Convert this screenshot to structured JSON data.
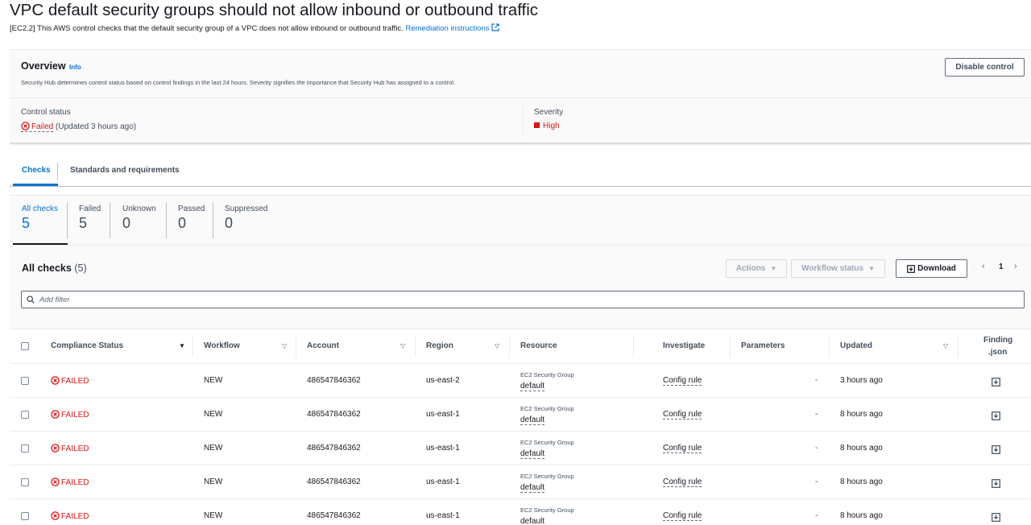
{
  "page": {
    "title": "VPC default security groups should not allow inbound or outbound traffic",
    "description": "[EC2.2] This AWS control checks that the default security group of a VPC does not allow inbound or outbound traffic.",
    "remediation_link": "Remediation instructions"
  },
  "overview": {
    "title": "Overview",
    "info": "Info",
    "description": "Security Hub determines control status based on control findings in the last 24 hours. Severity signifies the importance that Security Hub has assigned to a control.",
    "disable_button": "Disable control",
    "control_status_label": "Control status",
    "control_status_value": "Failed",
    "control_status_updated": "(Updated 3 hours ago)",
    "severity_label": "Severity",
    "severity_value": "High"
  },
  "tabs": [
    {
      "label": "Checks",
      "active": true
    },
    {
      "label": "Standards and requirements",
      "active": false
    }
  ],
  "stats": [
    {
      "label": "All checks",
      "value": "5"
    },
    {
      "label": "Failed",
      "value": "5"
    },
    {
      "label": "Unknown",
      "value": "0"
    },
    {
      "label": "Passed",
      "value": "0"
    },
    {
      "label": "Suppressed",
      "value": "0"
    }
  ],
  "table": {
    "title": "All checks",
    "count": "(5)",
    "actions_button": "Actions",
    "workflow_button": "Workflow status",
    "download_button": "Download",
    "page_number": "1",
    "filter_placeholder": "Add filter",
    "columns": {
      "compliance": "Compliance Status",
      "workflow": "Workflow",
      "account": "Account",
      "region": "Region",
      "resource": "Resource",
      "investigate": "Investigate",
      "parameters": "Parameters",
      "updated": "Updated",
      "finding_line1": "Finding",
      "finding_line2": ".json"
    },
    "rows": [
      {
        "status": "FAILED",
        "workflow": "NEW",
        "account": "486547846362",
        "region": "us-east-2",
        "resource_type": "EC2 Security Group",
        "resource_name": "default",
        "investigate": "Config rule",
        "parameters": "-",
        "updated": "3 hours ago"
      },
      {
        "status": "FAILED",
        "workflow": "NEW",
        "account": "486547846362",
        "region": "us-east-1",
        "resource_type": "EC2 Security Group",
        "resource_name": "default",
        "investigate": "Config rule",
        "parameters": "-",
        "updated": "8 hours ago"
      },
      {
        "status": "FAILED",
        "workflow": "NEW",
        "account": "486547846362",
        "region": "us-east-1",
        "resource_type": "EC2 Security Group",
        "resource_name": "default",
        "investigate": "Config rule",
        "parameters": "-",
        "updated": "8 hours ago"
      },
      {
        "status": "FAILED",
        "workflow": "NEW",
        "account": "486547846362",
        "region": "us-east-1",
        "resource_type": "EC2 Security Group",
        "resource_name": "default",
        "investigate": "Config rule",
        "parameters": "-",
        "updated": "8 hours ago"
      },
      {
        "status": "FAILED",
        "workflow": "NEW",
        "account": "486547846362",
        "region": "us-east-1",
        "resource_type": "EC2 Security Group",
        "resource_name": "default",
        "investigate": "Config rule",
        "parameters": "-",
        "updated": "8 hours ago"
      }
    ]
  },
  "colors": {
    "link": "#0972d3",
    "failed": "#d91515",
    "text": "#16191f"
  }
}
